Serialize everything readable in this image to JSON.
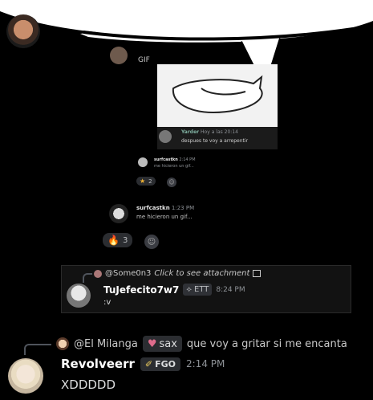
{
  "gif_badge": "GIF",
  "embedded_reply": {
    "username": "Yarder",
    "timestamp": "Hoy a las 20:14",
    "text": "despues te voy a arrepentir"
  },
  "small_message": {
    "username": "surfcastkn",
    "timestamp": "2:14 PM",
    "text": "me hicieron un gif...",
    "reaction_count": "2"
  },
  "mid_message": {
    "username": "surfcastkn",
    "timestamp": "1:23 PM",
    "text": "me hicieron un gif...",
    "reaction_count": "3"
  },
  "quoted_message": {
    "reply_author": "@Some0n3",
    "reply_action": "Click to see attachment",
    "username": "TuJefecito7w7",
    "tag": "ETT",
    "timestamp": "8:24 PM",
    "text": ":v"
  },
  "main_message": {
    "reply_author": "@El Milanga",
    "reply_tag": "sax",
    "reply_text": "que voy a gritar si me encanta",
    "username": "Revolveerr",
    "tag": "FGO",
    "timestamp": "2:14 PM",
    "text": "XDDDDD"
  },
  "colors": {
    "background": "#000000",
    "bubble": "#ffffff",
    "accent_heart": "#e06c8c"
  }
}
